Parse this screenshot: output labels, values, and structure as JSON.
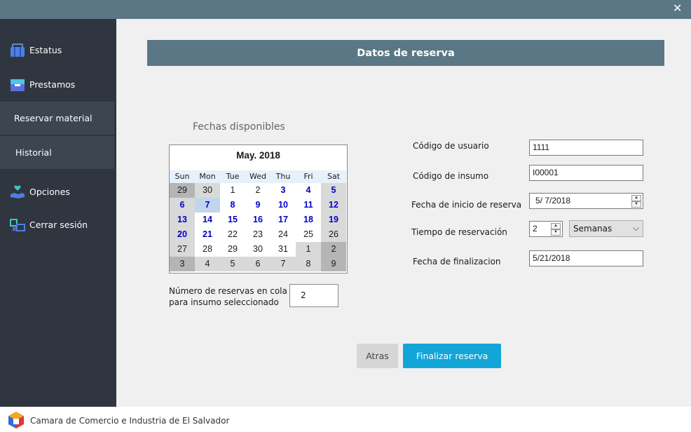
{
  "window": {
    "close_glyph": "✕"
  },
  "sidebar": {
    "items": [
      {
        "label": "Estatus",
        "icon": "briefcase-icon"
      },
      {
        "label": "Prestamos",
        "icon": "inbox-icon"
      },
      {
        "label": "Reservar material"
      },
      {
        "label": "Historial"
      },
      {
        "label": "Opciones",
        "icon": "hand-heart-icon"
      },
      {
        "label": "Cerrar sesión",
        "icon": "logout-icon"
      }
    ]
  },
  "main": {
    "header_title": "Datos de reserva",
    "calendar_title": "Fechas disponibles",
    "calendar": {
      "month_label": "May. 2018",
      "days_of_week": [
        "Sun",
        "Mon",
        "Tue",
        "Wed",
        "Thu",
        "Fri",
        "Sat"
      ],
      "weeks": [
        [
          "29",
          "30",
          "1",
          "2",
          "3",
          "4",
          "5"
        ],
        [
          "6",
          "7",
          "8",
          "9",
          "10",
          "11",
          "12"
        ],
        [
          "13",
          "14",
          "15",
          "16",
          "17",
          "18",
          "19"
        ],
        [
          "20",
          "21",
          "22",
          "23",
          "24",
          "25",
          "26"
        ],
        [
          "27",
          "28",
          "29",
          "30",
          "31",
          "1",
          "2"
        ],
        [
          "3",
          "4",
          "5",
          "6",
          "7",
          "8",
          "9"
        ]
      ],
      "selected_day": "7"
    },
    "queue_label_line1": "Número de reservas en cola",
    "queue_label_line2": "para insumo seleccionado",
    "queue_value": "2",
    "fields": {
      "usuario_label": "Código de usuario",
      "usuario_value": "1111",
      "insumo_label": "Código de insumo",
      "insumo_value": "I00001",
      "inicio_label": "Fecha de inicio de reserva",
      "inicio_value": "5/  7/2018",
      "tiempo_label": "Tiempo de reservación",
      "tiempo_value": "2",
      "tiempo_unit": "Semanas",
      "fin_label": "Fecha de finalizacion",
      "fin_value": "5/21/2018"
    },
    "buttons": {
      "back": "Atras",
      "finish": "Finalizar reserva"
    }
  },
  "footer": {
    "text": "Camara de Comercio e Industria de El Salvador"
  },
  "colors": {
    "accent": "#12a5d8",
    "header": "#5b7785",
    "sidebar": "#2f3640",
    "available_day": "#0000c8"
  }
}
